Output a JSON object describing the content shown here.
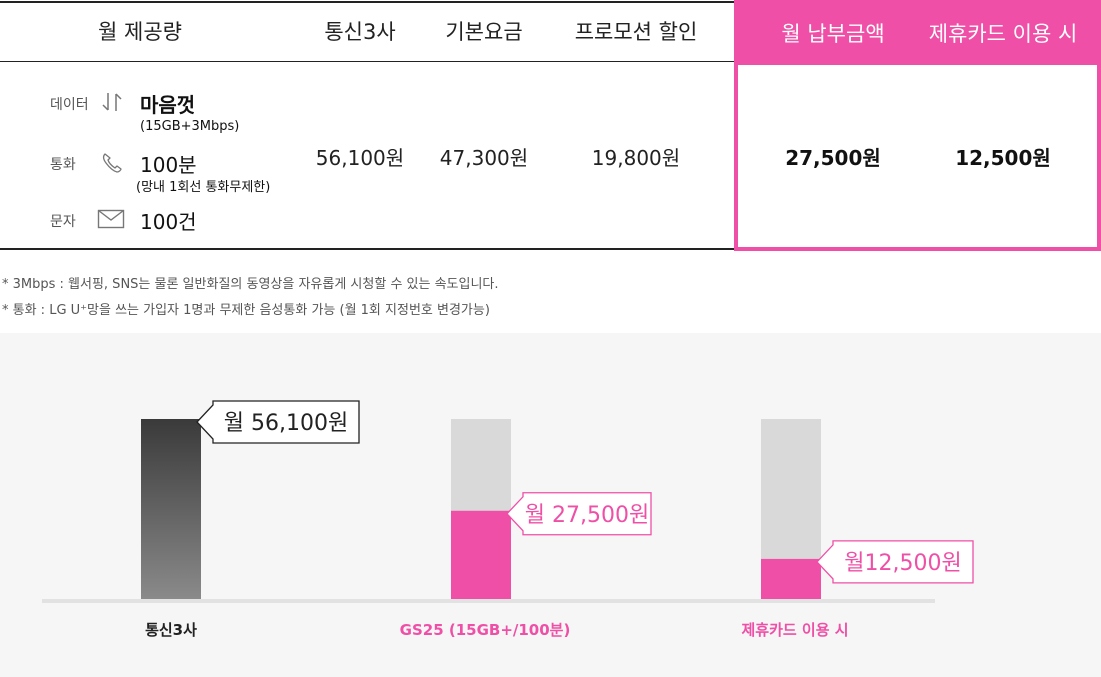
{
  "table": {
    "headers": [
      "월 제공량",
      "통신3사",
      "기본요금",
      "프로모션 할인",
      "월 납부금액",
      "제휴카드 이용 시"
    ],
    "specs": [
      {
        "label": "데이터",
        "icon": "data-arrows-icon",
        "main": "마음껏",
        "sub": "(15GB+3Mbps)"
      },
      {
        "label": "통화",
        "icon": "phone-icon",
        "main": "100분",
        "sub": "(망내 1회선 통화무제한)"
      },
      {
        "label": "문자",
        "icon": "envelope-icon",
        "main": "100건",
        "sub": ""
      }
    ],
    "values": {
      "carriers": "56,100원",
      "base_fee": "47,300원",
      "promo_discount": "19,800원",
      "monthly_payment": "27,500원",
      "with_card": "12,500원"
    }
  },
  "notes": [
    "* 3Mbps : 웹서핑, SNS는 물론 일반화질의 동영상을 자유롭게 시청할 수 있는 속도입니다.",
    "* 통화 : LG U⁺망을 쓰는 가입자 1명과 무제한 음성통화 가능 (월 1회 지정번호 변경가능)"
  ],
  "colors": {
    "accent": "#ef4fa6",
    "dark_bar_top": "#3a3a3a",
    "dark_bar_bottom": "#8a8a8a",
    "grey_bar": "#d9d9d9",
    "chart_bg": "#f6f6f6"
  },
  "chart_data": {
    "type": "bar",
    "categories": [
      "통신3사",
      "GS25 (15GB+/100분)",
      "제휴카드 이용 시"
    ],
    "values": [
      56100,
      27500,
      12500
    ],
    "reference_value": 56100,
    "data_labels": [
      "월 56,100원",
      "월 27,500원",
      "월12,500원"
    ],
    "ylim": [
      0,
      56100
    ],
    "grid": false,
    "legend": "none"
  }
}
